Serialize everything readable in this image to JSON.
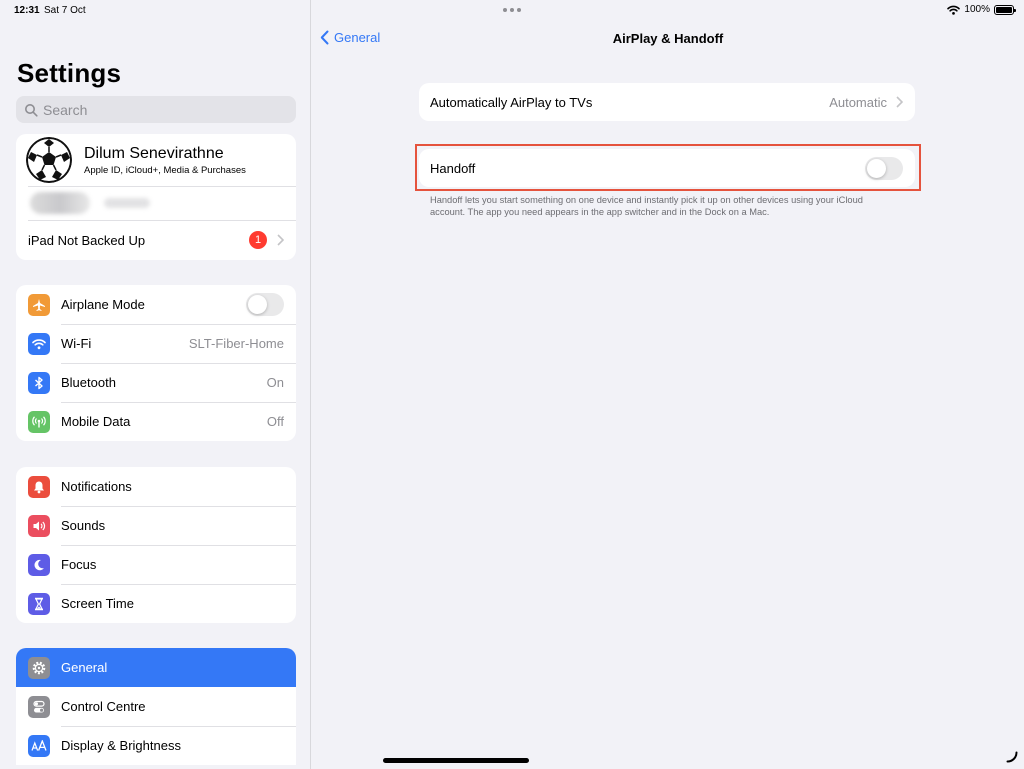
{
  "status_bar": {
    "time": "12:31",
    "date": "Sat 7 Oct",
    "battery": "100%",
    "battery_level": 1.0
  },
  "sidebar": {
    "title": "Settings",
    "search_placeholder": "Search",
    "profile": {
      "name": "Dilum Senevirathne",
      "subtitle": "Apple ID, iCloud+, Media & Purchases"
    },
    "backup": {
      "label": "iPad Not Backed Up",
      "badge": "1"
    },
    "groups": [
      [
        {
          "label": "Airplane Mode",
          "icon": "airplane-icon",
          "color": "#f19a37",
          "value": "",
          "toggle": true,
          "toggle_on": false
        },
        {
          "label": "Wi-Fi",
          "icon": "wifi-icon",
          "color": "#3478f6",
          "value": "SLT-Fiber-Home"
        },
        {
          "label": "Bluetooth",
          "icon": "bluetooth-icon",
          "color": "#3478f6",
          "value": "On"
        },
        {
          "label": "Mobile Data",
          "icon": "antenna-icon",
          "color": "#65c466",
          "value": "Off"
        }
      ],
      [
        {
          "label": "Notifications",
          "icon": "bell-icon",
          "color": "#eb4d3d",
          "value": ""
        },
        {
          "label": "Sounds",
          "icon": "speaker-icon",
          "color": "#eb4e5f",
          "value": ""
        },
        {
          "label": "Focus",
          "icon": "moon-icon",
          "color": "#5e5ce6",
          "value": ""
        },
        {
          "label": "Screen Time",
          "icon": "hourglass-icon",
          "color": "#5e5ce6",
          "value": ""
        }
      ],
      [
        {
          "label": "General",
          "icon": "gear-icon",
          "color": "#8e8e93",
          "value": "",
          "selected": true
        },
        {
          "label": "Control Centre",
          "icon": "switches-icon",
          "color": "#8e8e93",
          "value": ""
        },
        {
          "label": "Display & Brightness",
          "icon": "text-size-icon",
          "color": "#3478f6",
          "value": ""
        }
      ]
    ]
  },
  "detail": {
    "back_label": "General",
    "title": "AirPlay & Handoff",
    "airplay": {
      "label": "Automatically AirPlay to TVs",
      "value": "Automatic"
    },
    "handoff": {
      "label": "Handoff",
      "toggle_on": false
    },
    "footnote": "Handoff lets you start something on one device and instantly pick it up on other devices using your iCloud account. The app you need appears in the app switcher and in the Dock on a Mac."
  },
  "colors": {
    "accent": "#3478f6",
    "highlight_outline": "#e5533d",
    "badge": "#ff3b30"
  }
}
